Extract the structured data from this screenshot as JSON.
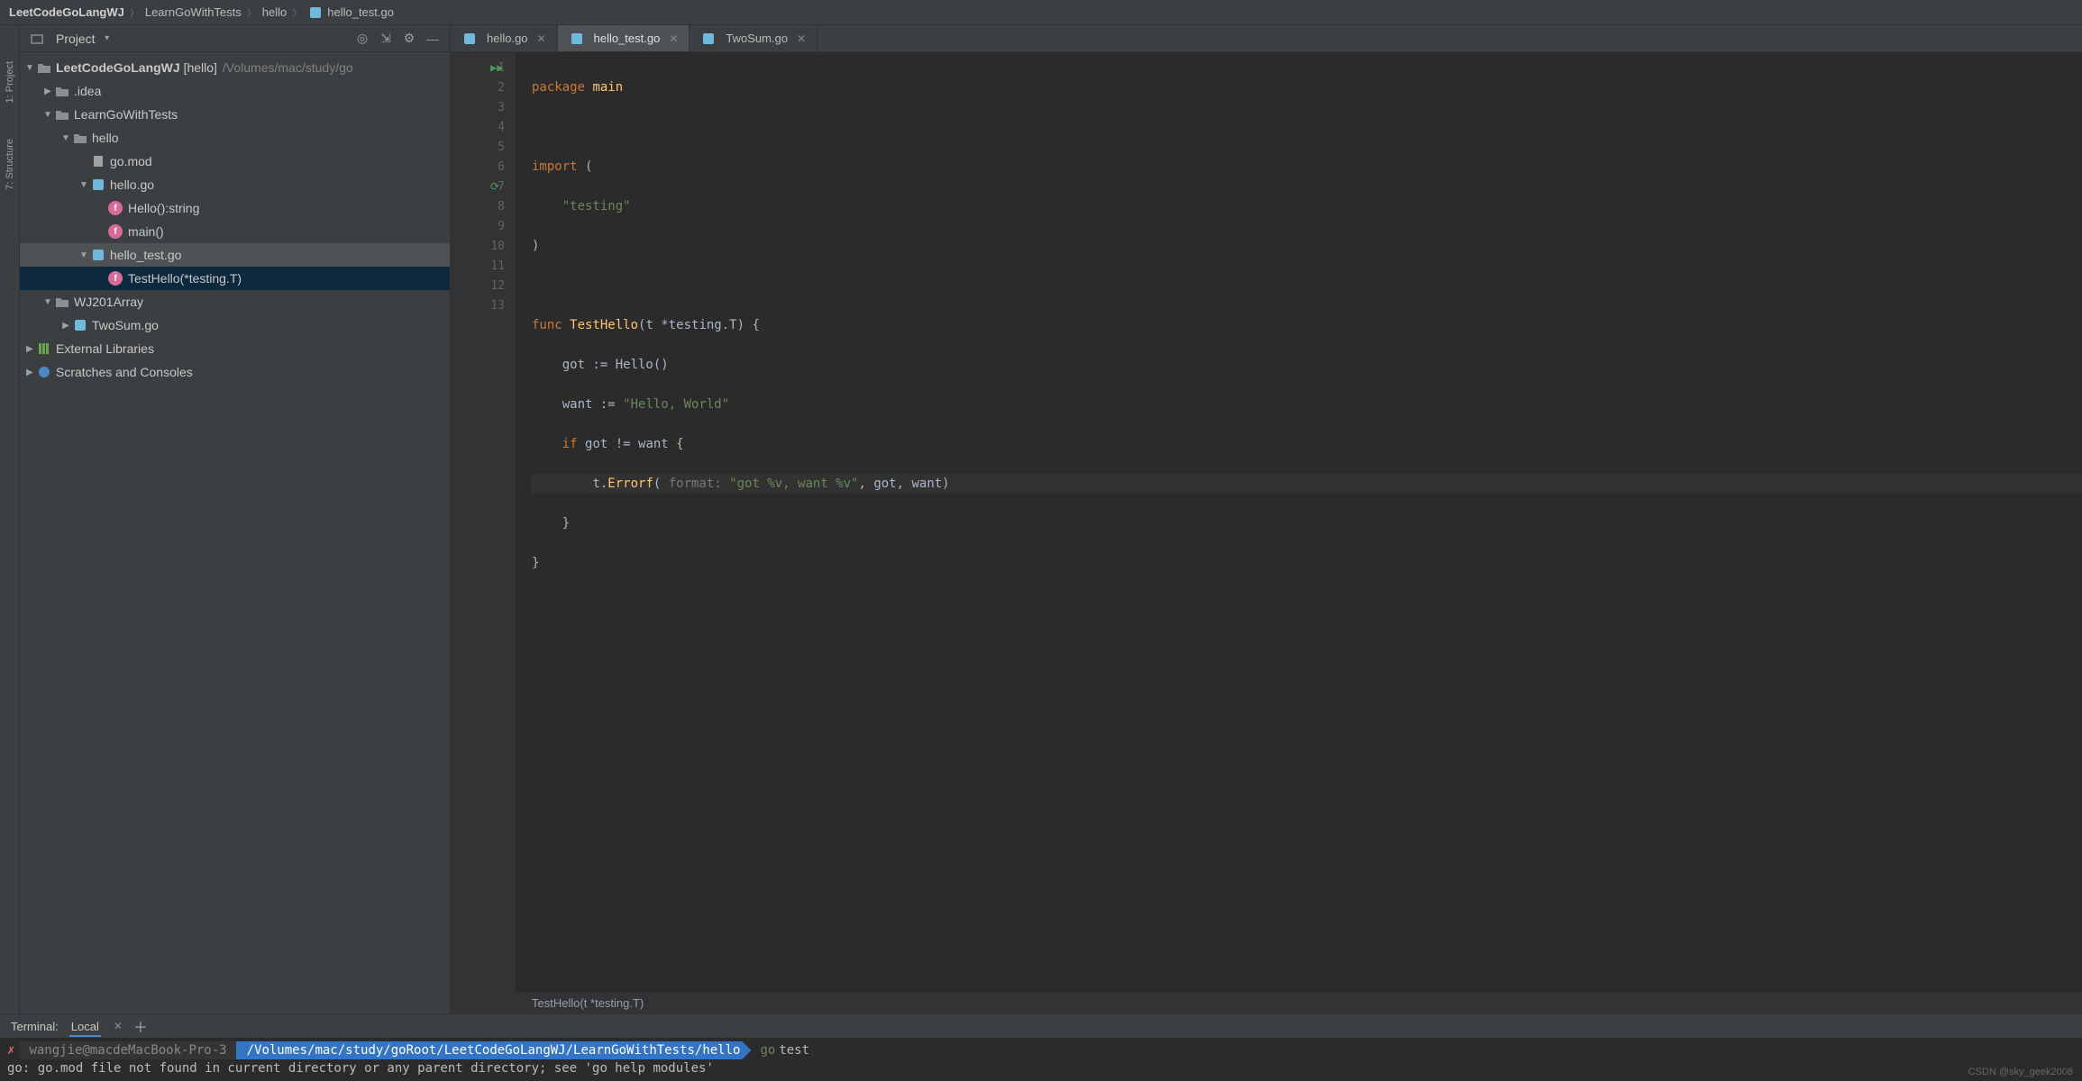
{
  "breadcrumb": [
    "LeetCodeGoLangWJ",
    "LearnGoWithTests",
    "hello",
    "hello_test.go"
  ],
  "sidebar_tools": {
    "project": "1: Project",
    "structure": "7: Structure"
  },
  "project_pane": {
    "title": "Project",
    "actions": [
      "target-icon",
      "expand-icon",
      "gear-icon",
      "minimize-icon"
    ]
  },
  "tree": {
    "root": {
      "name": "LeetCodeGoLangWJ",
      "context": "[hello]",
      "path": "/Volumes/mac/study/go"
    },
    "idea": ".idea",
    "learn": "LearnGoWithTests",
    "hello_dir": "hello",
    "go_mod": "go.mod",
    "hello_go": "hello.go",
    "hello_fn": "Hello():string",
    "main_fn": "main()",
    "hello_test": "hello_test.go",
    "test_fn": "TestHello(*testing.T)",
    "wj_array": "WJ201Array",
    "two_sum": "TwoSum.go",
    "ext_lib": "External Libraries",
    "scratches": "Scratches and Consoles"
  },
  "tabs": [
    {
      "label": "hello.go",
      "active": false
    },
    {
      "label": "hello_test.go",
      "active": true
    },
    {
      "label": "TwoSum.go",
      "active": false
    }
  ],
  "code": {
    "lines": 13,
    "l1": {
      "kw": "package",
      "id": "main"
    },
    "l3": {
      "kw": "import",
      "p": "("
    },
    "l4": {
      "str": "\"testing\""
    },
    "l5": {
      "p": ")"
    },
    "l7": {
      "kw": "func",
      "fn": "TestHello",
      "sig": "(t *testing.T) {"
    },
    "l8": "got := Hello()",
    "l9": {
      "pre": "want := ",
      "str": "\"Hello, World\""
    },
    "l10": {
      "kw": "if",
      "rest": "got != want {"
    },
    "l11": {
      "pre": "t.",
      "fn": "Errorf",
      "open": "(",
      "hint": " format: ",
      "str": "\"got %v, want %v\"",
      "rest": ", got, want)"
    },
    "l12": "}",
    "l13": "}"
  },
  "status": "TestHello(t *testing.T)",
  "terminal": {
    "title": "Terminal:",
    "tab": "Local",
    "user": "wangjie@macdeMacBook-Pro-3",
    "path": "/Volumes/mac/study/goRoot/LeetCodeGoLangWJ/LearnGoWithTests/hello",
    "go_prompt": "go",
    "cmd": "test",
    "out": "go: go.mod file not found in current directory or any parent directory; see 'go help modules'"
  },
  "watermark": "CSDN @sky_geek2008"
}
